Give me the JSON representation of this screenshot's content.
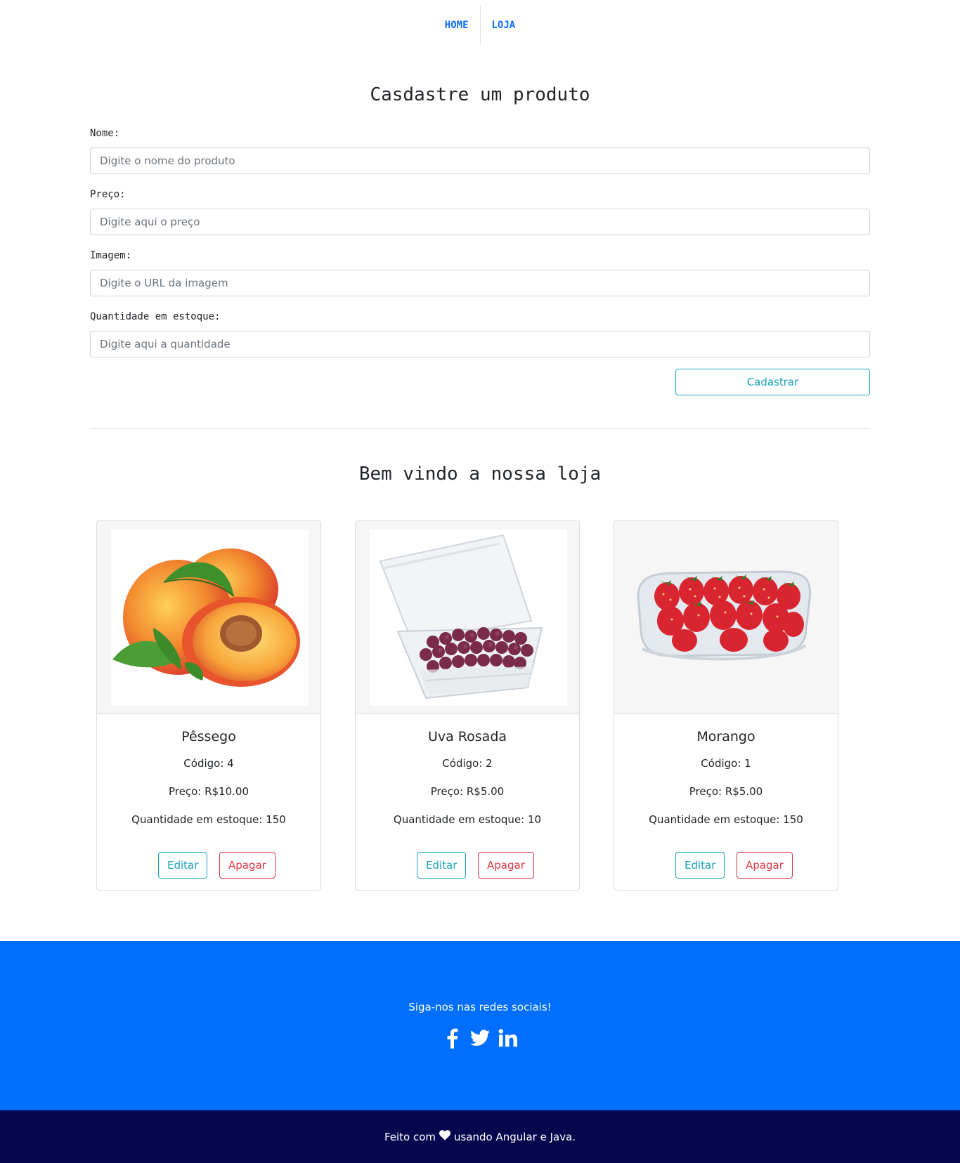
{
  "nav": {
    "home": "HOME",
    "store": "LOJA",
    "link_color": "#0d6efd"
  },
  "form": {
    "title": "Casdastre um produto",
    "name_label": "Nome:",
    "name_placeholder": "Digite o nome do produto",
    "name_value": "",
    "price_label": "Preço:",
    "price_placeholder": "Digite aqui o preço",
    "price_value": "",
    "image_label": "Imagem:",
    "image_placeholder": "Digite o URL da imagem",
    "image_value": "",
    "qty_label": "Quantidade em estoque:",
    "qty_placeholder": "Digite aqui a quantidade",
    "qty_value": "",
    "submit_label": "Cadastrar"
  },
  "store": {
    "title": "Bem vindo a nossa loja",
    "products": [
      {
        "name": "Pêssego",
        "code": "Código: 4",
        "price": "Preço: R$10.00",
        "stock": "Quantidade em estoque: 150",
        "image": "peach",
        "edit_label": "Editar",
        "delete_label": "Apagar"
      },
      {
        "name": "Uva Rosada",
        "code": "Código: 2",
        "price": "Preço: R$5.00",
        "stock": "Quantidade em estoque: 10",
        "image": "grapes-in-plastic-box",
        "edit_label": "Editar",
        "delete_label": "Apagar"
      },
      {
        "name": "Morango",
        "code": "Código: 1",
        "price": "Preço: R$5.00",
        "stock": "Quantidade em estoque: 150",
        "image": "strawberries-in-tray",
        "edit_label": "Editar",
        "delete_label": "Apagar"
      }
    ]
  },
  "footer": {
    "social_text": "Siga-nos nas redes sociais!",
    "social_icons": [
      "facebook-icon",
      "twitter-icon",
      "linkedin-icon"
    ],
    "made_prefix": "Feito com",
    "made_suffix": "usando Angular e Java.",
    "heart_icon": "heart-icon",
    "blue": "#006fff",
    "dark": "#06064e"
  },
  "colors": {
    "info": "#17a2b8",
    "danger": "#dc3545"
  }
}
